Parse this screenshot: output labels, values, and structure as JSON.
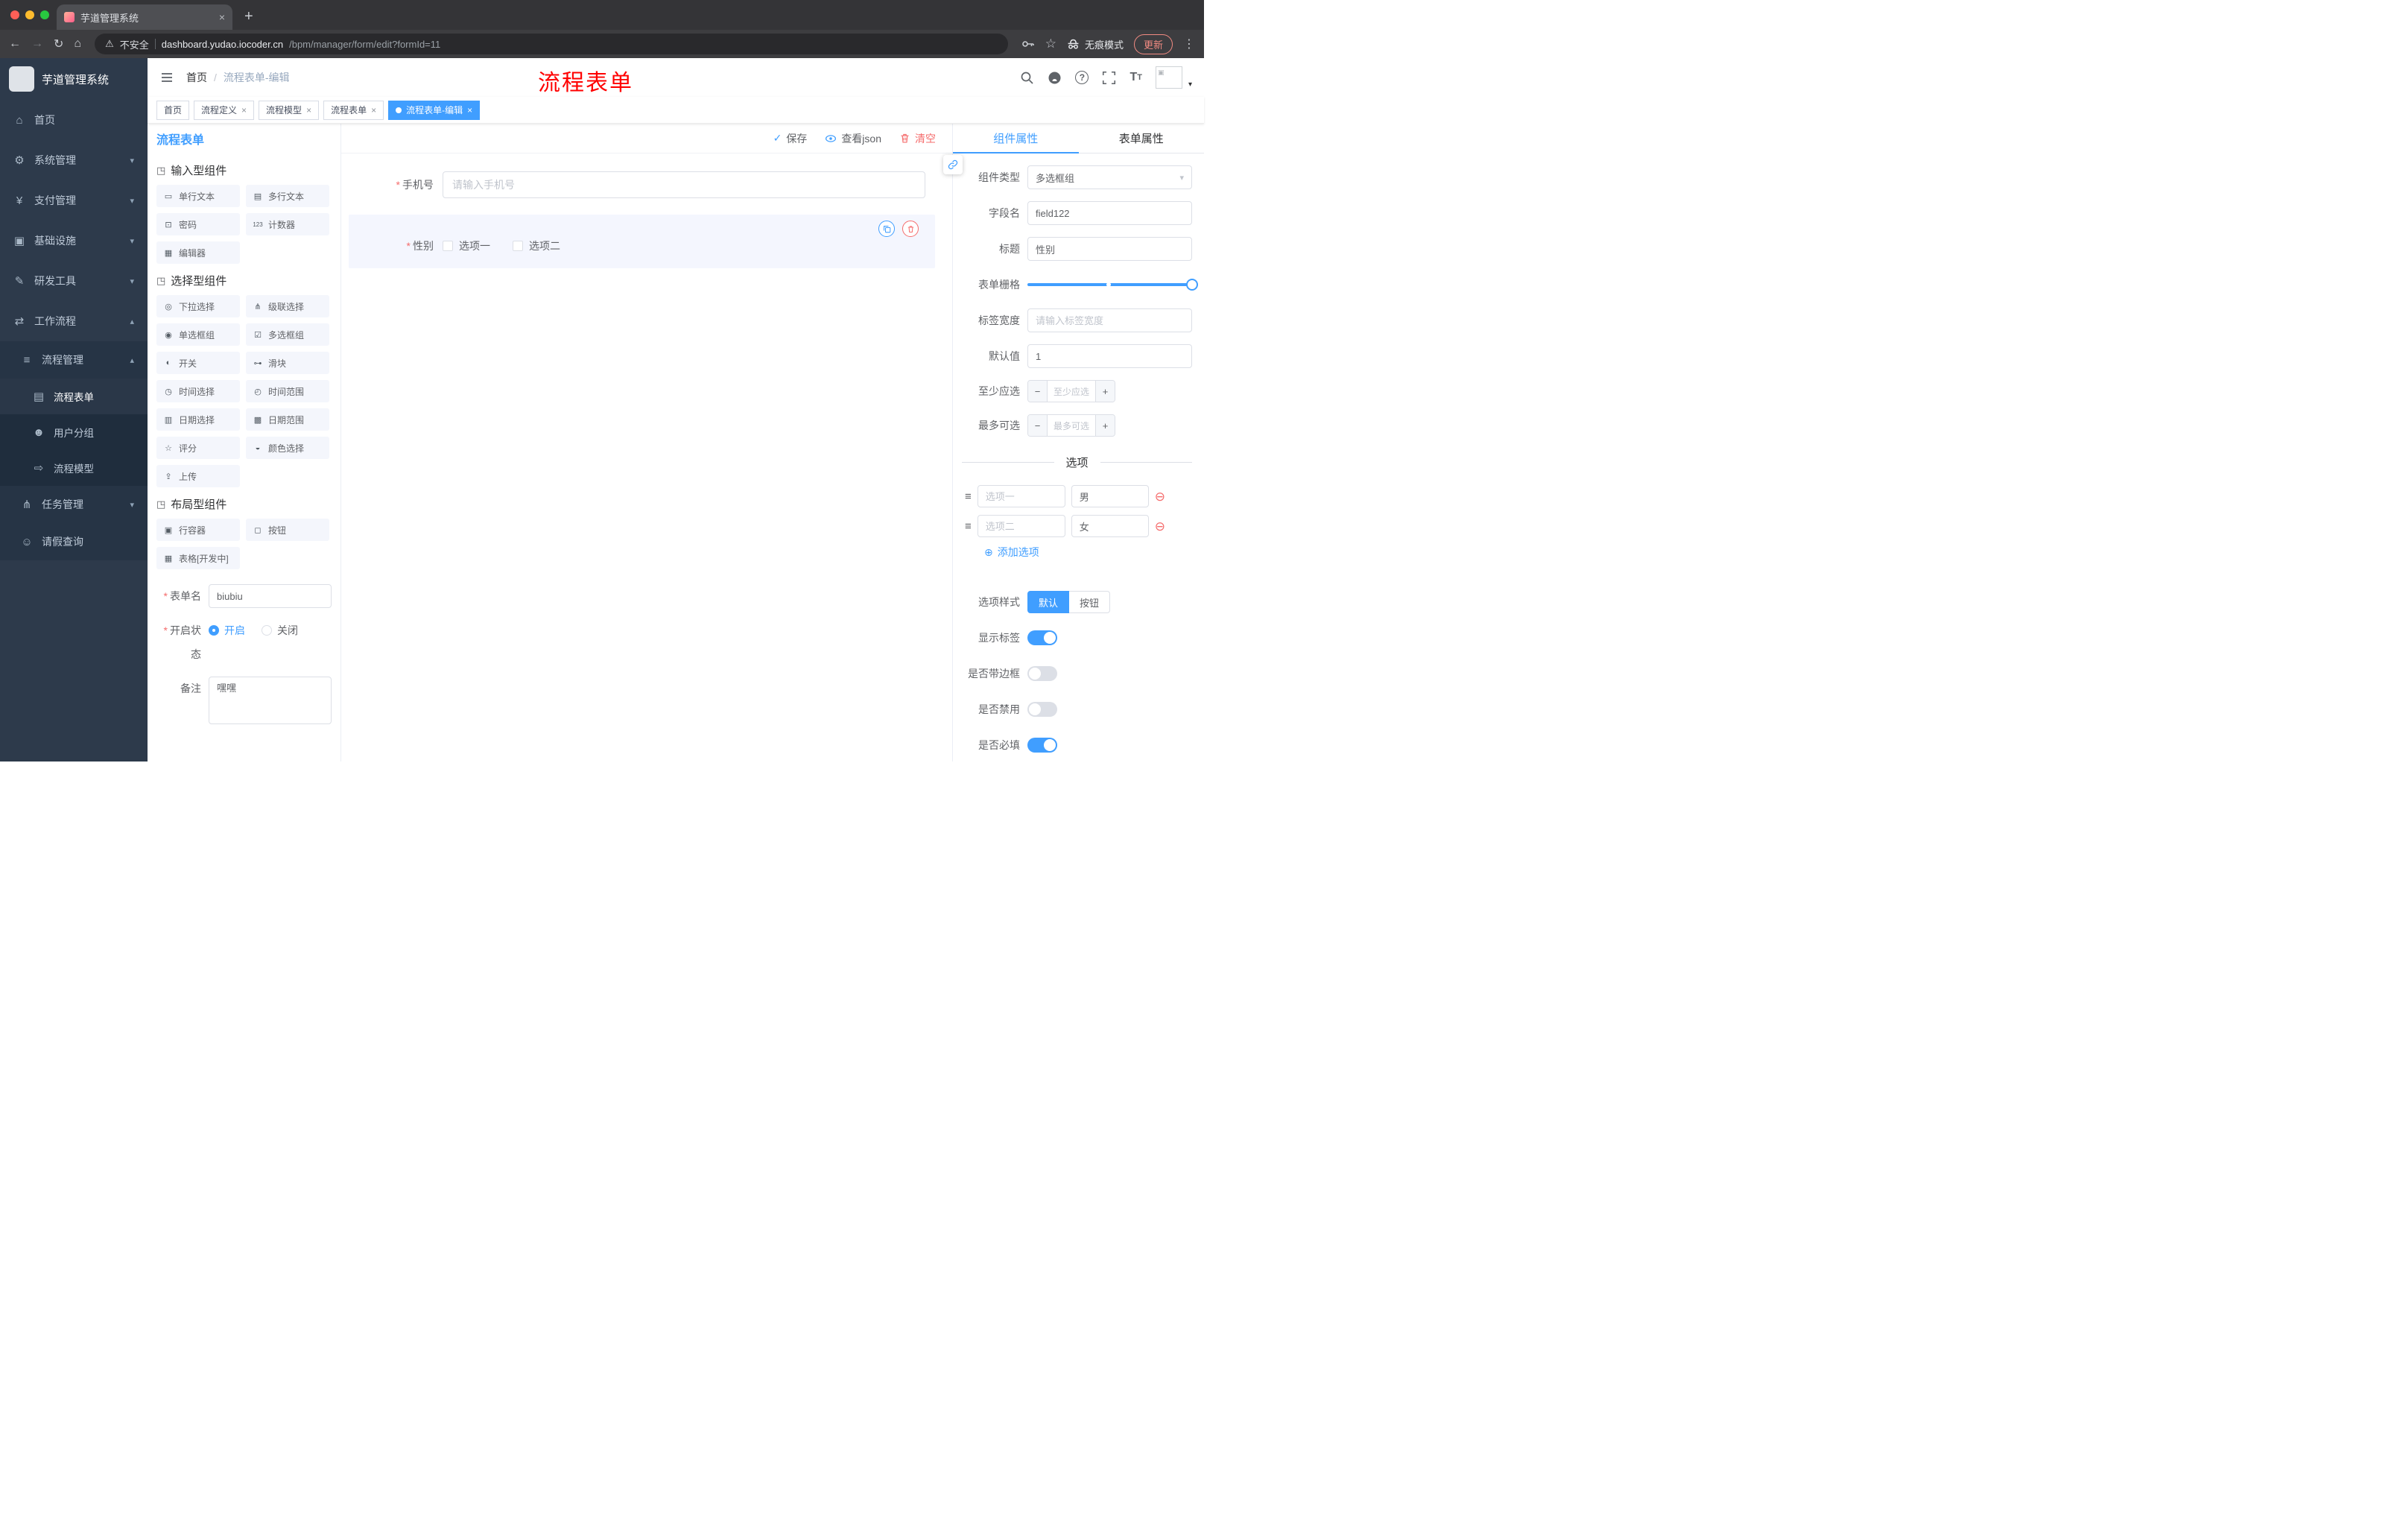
{
  "colors": {
    "accent": "#409eff",
    "danger": "#f56c6c",
    "annotation_red": "#ff0000",
    "sidebar_bg": "#2d3a4b"
  },
  "browser": {
    "tab_title": "芋道管理系统",
    "security_label": "不安全",
    "url_host": "dashboard.yudao.iocoder.cn",
    "url_path": "/bpm/manager/form/edit?formId=11",
    "incognito_label": "无痕模式",
    "update_label": "更新"
  },
  "sidebar": {
    "app_title": "芋道管理系统",
    "menu": [
      {
        "label": "首页",
        "icon": "⌂"
      },
      {
        "label": "系统管理",
        "icon": "⚙"
      },
      {
        "label": "支付管理",
        "icon": "¥"
      },
      {
        "label": "基础设施",
        "icon": "▣"
      },
      {
        "label": "研发工具",
        "icon": "✎"
      },
      {
        "label": "工作流程",
        "icon": "⇄"
      },
      {
        "label": "流程管理",
        "icon": "≡"
      },
      {
        "label": "流程表单",
        "icon": "▤"
      },
      {
        "label": "用户分组",
        "icon": "☻"
      },
      {
        "label": "流程模型",
        "icon": "⇨"
      },
      {
        "label": "任务管理",
        "icon": "⋔"
      },
      {
        "label": "请假查询",
        "icon": "☺"
      }
    ]
  },
  "header": {
    "breadcrumb_home": "首页",
    "breadcrumb_current": "流程表单-编辑",
    "overlay_title": "流程表单"
  },
  "tags": [
    {
      "label": "首页"
    },
    {
      "label": "流程定义"
    },
    {
      "label": "流程模型"
    },
    {
      "label": "流程表单"
    },
    {
      "label": "流程表单-编辑"
    }
  ],
  "palette": {
    "title": "流程表单",
    "groups": [
      {
        "title": "输入型组件",
        "items": [
          {
            "label": "单行文本",
            "icon": "▭"
          },
          {
            "label": "多行文本",
            "icon": "▤"
          },
          {
            "label": "密码",
            "icon": "⊡"
          },
          {
            "label": "计数器",
            "icon": "123"
          },
          {
            "label": "编辑器",
            "icon": "▦"
          }
        ]
      },
      {
        "title": "选择型组件",
        "items": [
          {
            "label": "下拉选择",
            "icon": "◎"
          },
          {
            "label": "级联选择",
            "icon": "⋔"
          },
          {
            "label": "单选框组",
            "icon": "◉"
          },
          {
            "label": "多选框组",
            "icon": "☑"
          },
          {
            "label": "开关",
            "icon": "◐"
          },
          {
            "label": "滑块",
            "icon": "⊶"
          },
          {
            "label": "时间选择",
            "icon": "◷"
          },
          {
            "label": "时间范围",
            "icon": "◴"
          },
          {
            "label": "日期选择",
            "icon": "▥"
          },
          {
            "label": "日期范围",
            "icon": "▩"
          },
          {
            "label": "评分",
            "icon": "☆"
          },
          {
            "label": "颜色选择",
            "icon": "◒"
          },
          {
            "label": "上传",
            "icon": "⇪"
          }
        ]
      },
      {
        "title": "布局型组件",
        "items": [
          {
            "label": "行容器",
            "icon": "▣"
          },
          {
            "label": "按钮",
            "icon": "◻"
          },
          {
            "label": "表格[开发中]",
            "icon": "▦"
          }
        ]
      }
    ],
    "form": {
      "name_label": "表单名",
      "name_value": "biubiu",
      "status_label": "开启状态",
      "status_on": "开启",
      "status_off": "关闭",
      "remark_label": "备注",
      "remark_value": "嘿嘿"
    }
  },
  "canvas": {
    "save_label": "保存",
    "view_json_label": "查看json",
    "clear_label": "清空",
    "phone": {
      "label": "手机号",
      "placeholder": "请输入手机号"
    },
    "gender": {
      "label": "性别",
      "option1": "选项一",
      "option2": "选项二"
    }
  },
  "props": {
    "tab_component": "组件属性",
    "tab_form": "表单属性",
    "component_type_label": "组件类型",
    "component_type_value": "多选框组",
    "field_name_label": "字段名",
    "field_name_value": "field122",
    "title_label": "标题",
    "title_value": "性别",
    "grid_label": "表单栅格",
    "label_width_label": "标签宽度",
    "label_width_placeholder": "请输入标签宽度",
    "default_label": "默认值",
    "default_value": "1",
    "min_label": "至少应选",
    "min_placeholder": "至少应选",
    "max_label": "最多可选",
    "max_placeholder": "最多可选",
    "options_divider": "选项",
    "options": [
      {
        "label_placeholder": "选项一",
        "value": "男"
      },
      {
        "label_placeholder": "选项二",
        "value": "女"
      }
    ],
    "add_option_label": "添加选项",
    "option_style_label": "选项样式",
    "style_default": "默认",
    "style_button": "按钮",
    "show_label_label": "显示标签",
    "show_label_on": true,
    "border_label": "是否带边框",
    "border_on": false,
    "disabled_label": "是否禁用",
    "disabled_on": false,
    "required_label": "是否必填",
    "required_on": true
  }
}
